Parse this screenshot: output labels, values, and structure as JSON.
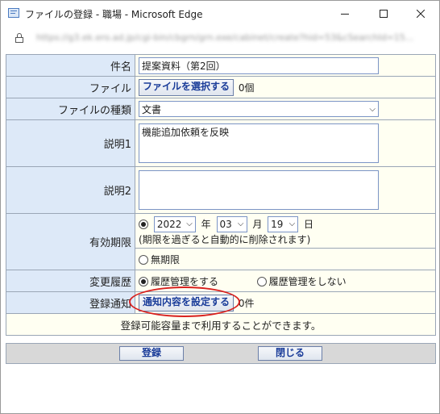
{
  "window": {
    "title": "ファイルの登録 - 職場 - Microsoft Edge",
    "url": "https://g3.ek.ero.ad.jp/cgi-bin/cbgrn/grn.exe/cabinet/create?hid=53&cSearchId=15...",
    "minimize_icon": "minimize-icon",
    "maximize_icon": "maximize-icon",
    "close_icon": "close-icon"
  },
  "form": {
    "name": {
      "label": "件名",
      "value": "提案資料（第2回）"
    },
    "file": {
      "label": "ファイル",
      "button": "ファイルを選択する",
      "count": "0個"
    },
    "kind": {
      "label": "ファイルの種類",
      "value": "文書"
    },
    "desc1": {
      "label": "説明1",
      "value": "機能追加依頼を反映"
    },
    "desc2": {
      "label": "説明2",
      "value": ""
    },
    "expiry": {
      "label": "有効期限",
      "year": "2022",
      "year_unit": "年",
      "month": "03",
      "month_unit": "月",
      "day": "19",
      "day_unit": "日",
      "note": "(期限を過ぎると自動的に削除されます)",
      "no_limit": "無期限"
    },
    "history": {
      "label": "変更履歴",
      "option_on": "履歴管理をする",
      "option_off": "履歴管理をしない"
    },
    "notify": {
      "label": "登録通知",
      "button": "通知内容を設定する",
      "count": "0件"
    },
    "info": "登録可能容量まで利用することができます。"
  },
  "footer": {
    "register": "登録",
    "close": "閉じる"
  },
  "colors": {
    "label_bg": "#dde9f8",
    "value_bg": "#fffff2",
    "button_text": "#1a3c99",
    "highlight": "#d8201e"
  }
}
